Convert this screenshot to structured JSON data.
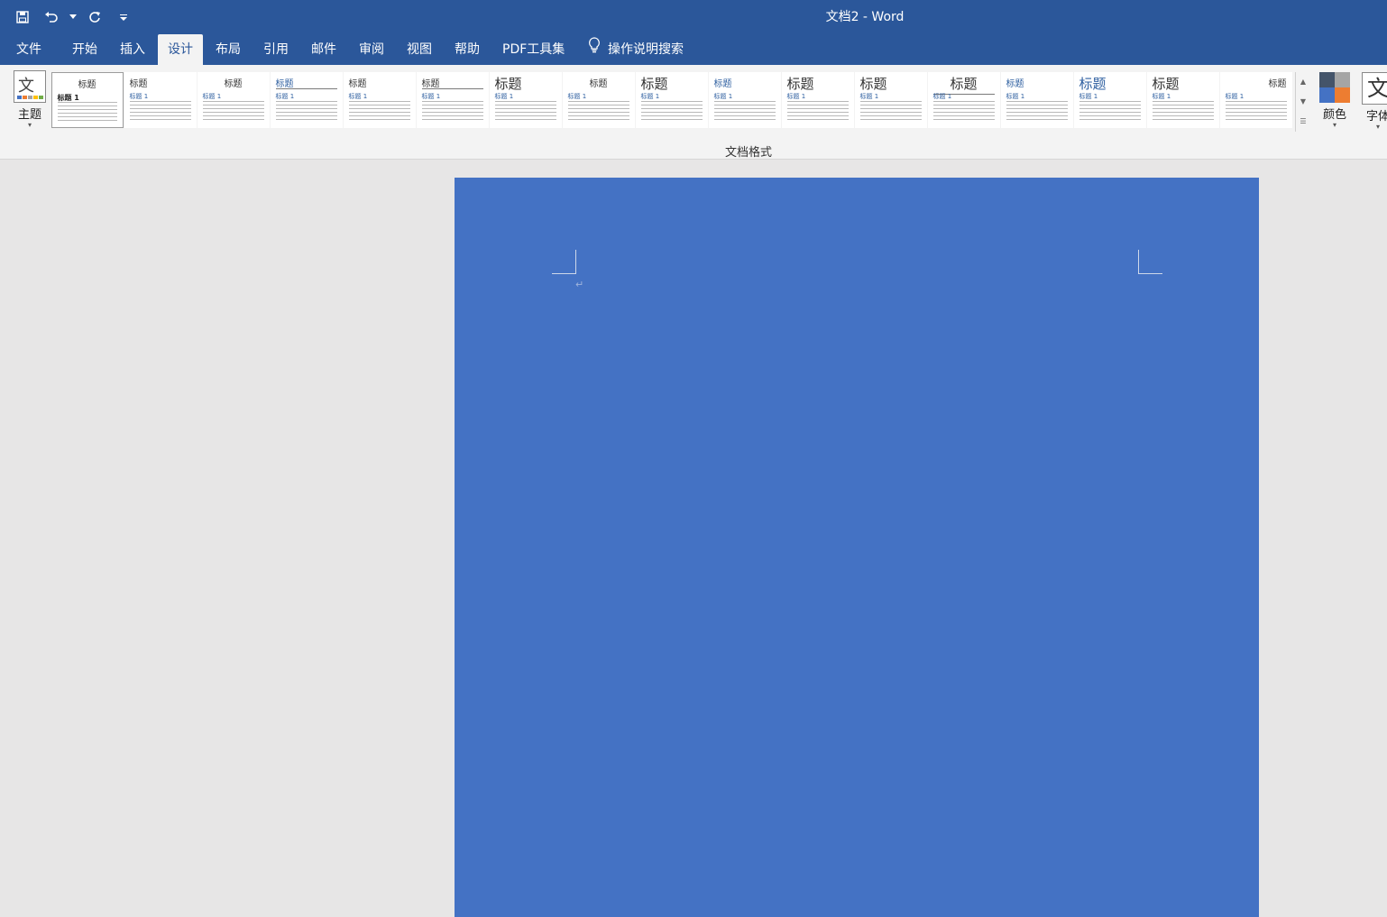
{
  "window": {
    "title": "文档2  -  Word"
  },
  "quick_access": {
    "save_icon": "save-icon",
    "undo_icon": "undo-icon",
    "redo_icon": "redo-icon",
    "customize_icon": "customize-icon"
  },
  "menu": {
    "tabs": [
      "文件",
      "开始",
      "插入",
      "设计",
      "布局",
      "引用",
      "邮件",
      "审阅",
      "视图",
      "帮助",
      "PDF工具集"
    ],
    "active_tab": "设计",
    "search_label": "操作说明搜索"
  },
  "ribbon": {
    "theme_label": "主题",
    "colors_label": "颜色",
    "fonts_label": "字体",
    "group_label": "文档格式",
    "style_title": "标题",
    "style_heading1": "标题 1",
    "style_count": 17
  },
  "colors": {
    "titlebar": "#2b579a",
    "ribbon": "#f3f3f3",
    "page_fill": "#4472c4",
    "canvas": "#e7e6e6"
  }
}
